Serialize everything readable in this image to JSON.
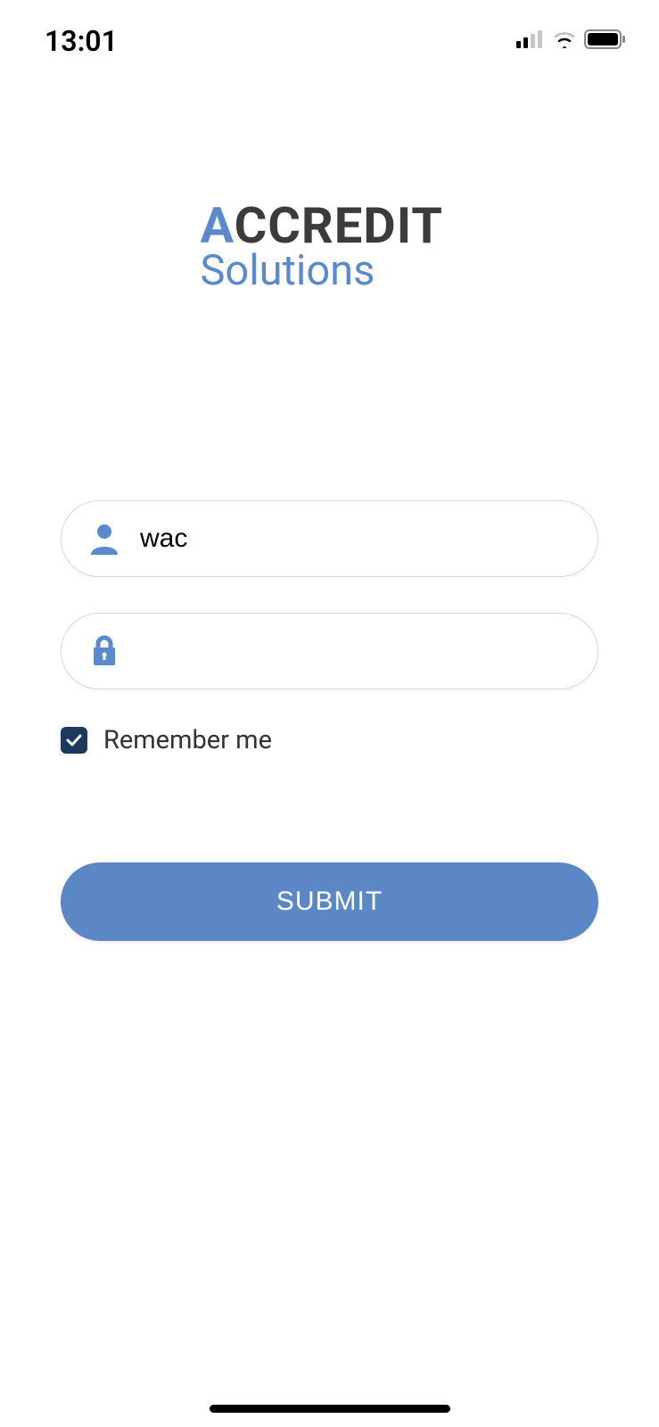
{
  "status_bar": {
    "time": "13:01"
  },
  "logo": {
    "line1_accent": "A",
    "line1_rest": "CCREDIT",
    "line2": "Solutions"
  },
  "form": {
    "username_value": "wac",
    "password_value": "",
    "remember_label": "Remember me",
    "remember_checked": true,
    "submit_label": "SUBMIT"
  },
  "colors": {
    "accent": "#5a8acb",
    "button": "#5b87c4",
    "checkbox": "#1c3a5e"
  }
}
